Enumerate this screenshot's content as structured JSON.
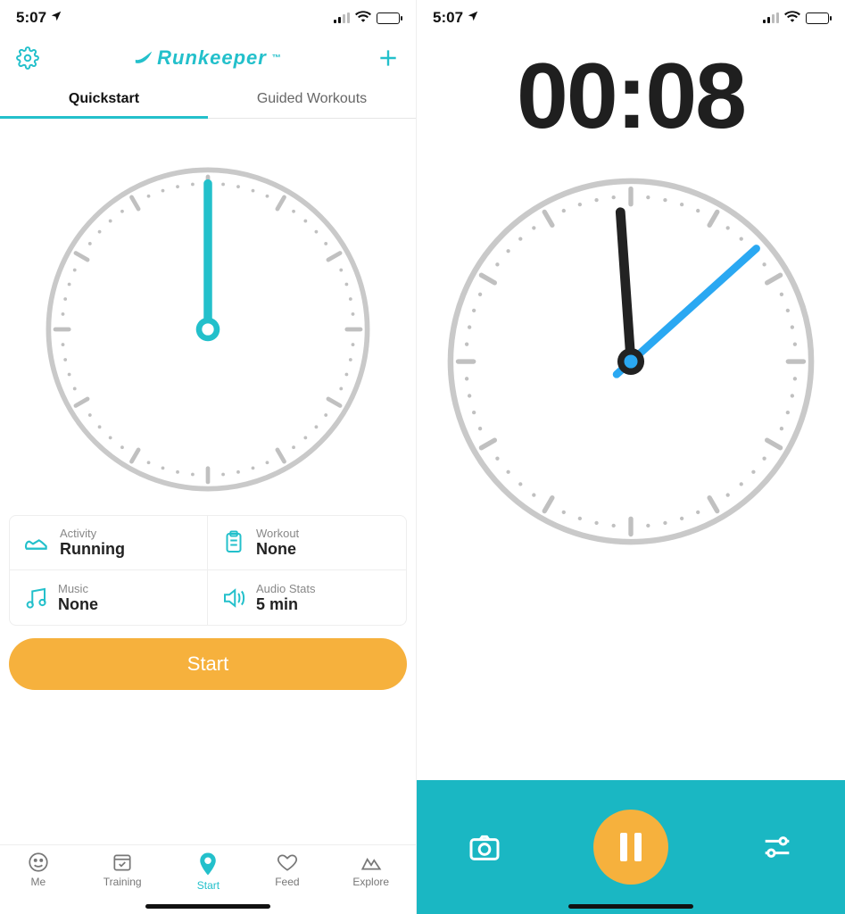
{
  "status": {
    "time": "5:07"
  },
  "left": {
    "brand": "Runkeeper",
    "tabs": {
      "quickstart": "Quickstart",
      "guided": "Guided Workouts"
    },
    "clock": {
      "minute_angle": 0,
      "second_angle": 0
    },
    "options": {
      "activity": {
        "label": "Activity",
        "value": "Running"
      },
      "workout": {
        "label": "Workout",
        "value": "None"
      },
      "music": {
        "label": "Music",
        "value": "None"
      },
      "audio": {
        "label": "Audio Stats",
        "value": "5 min"
      }
    },
    "start_label": "Start",
    "tabbar": {
      "me": "Me",
      "training": "Training",
      "start": "Start",
      "feed": "Feed",
      "explore": "Explore"
    }
  },
  "right": {
    "elapsed": "00:08",
    "clock": {
      "minute_angle": -4,
      "second_angle": 48
    }
  },
  "colors": {
    "accent": "#23c0cb",
    "orange": "#f6b13d",
    "teal_bar": "#1ab7c3"
  }
}
